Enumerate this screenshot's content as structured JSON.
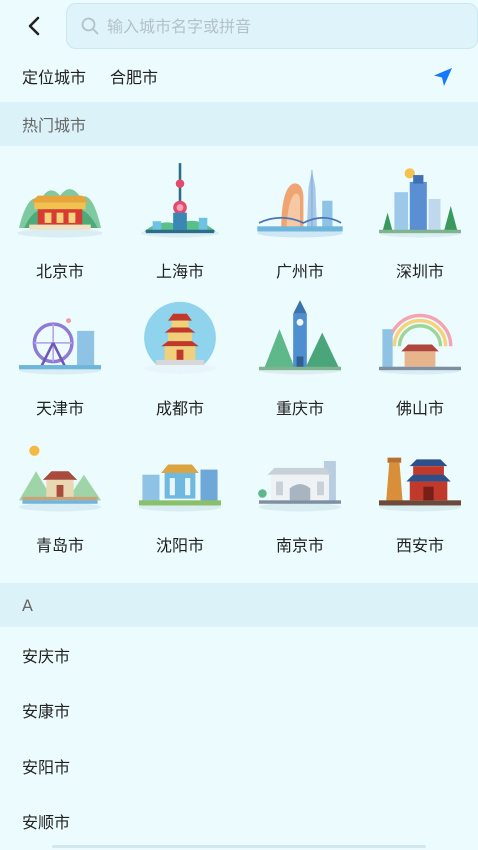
{
  "search": {
    "placeholder": "输入城市名字或拼音"
  },
  "location": {
    "label": "定位城市",
    "city": "合肥市"
  },
  "hot_section": {
    "title": "热门城市"
  },
  "hot_cities": [
    {
      "name": "北京市"
    },
    {
      "name": "上海市"
    },
    {
      "name": "广州市"
    },
    {
      "name": "深圳市"
    },
    {
      "name": "天津市"
    },
    {
      "name": "成都市"
    },
    {
      "name": "重庆市"
    },
    {
      "name": "佛山市"
    },
    {
      "name": "青岛市"
    },
    {
      "name": "沈阳市"
    },
    {
      "name": "南京市"
    },
    {
      "name": "西安市"
    }
  ],
  "index_section": {
    "letter": "A"
  },
  "cities_a": [
    {
      "name": "安庆市"
    },
    {
      "name": "安康市"
    },
    {
      "name": "安阳市"
    },
    {
      "name": "安顺市"
    }
  ],
  "colors": {
    "accent": "#1677ff",
    "background": "#ecfbfd",
    "section": "#dbf2f9"
  }
}
